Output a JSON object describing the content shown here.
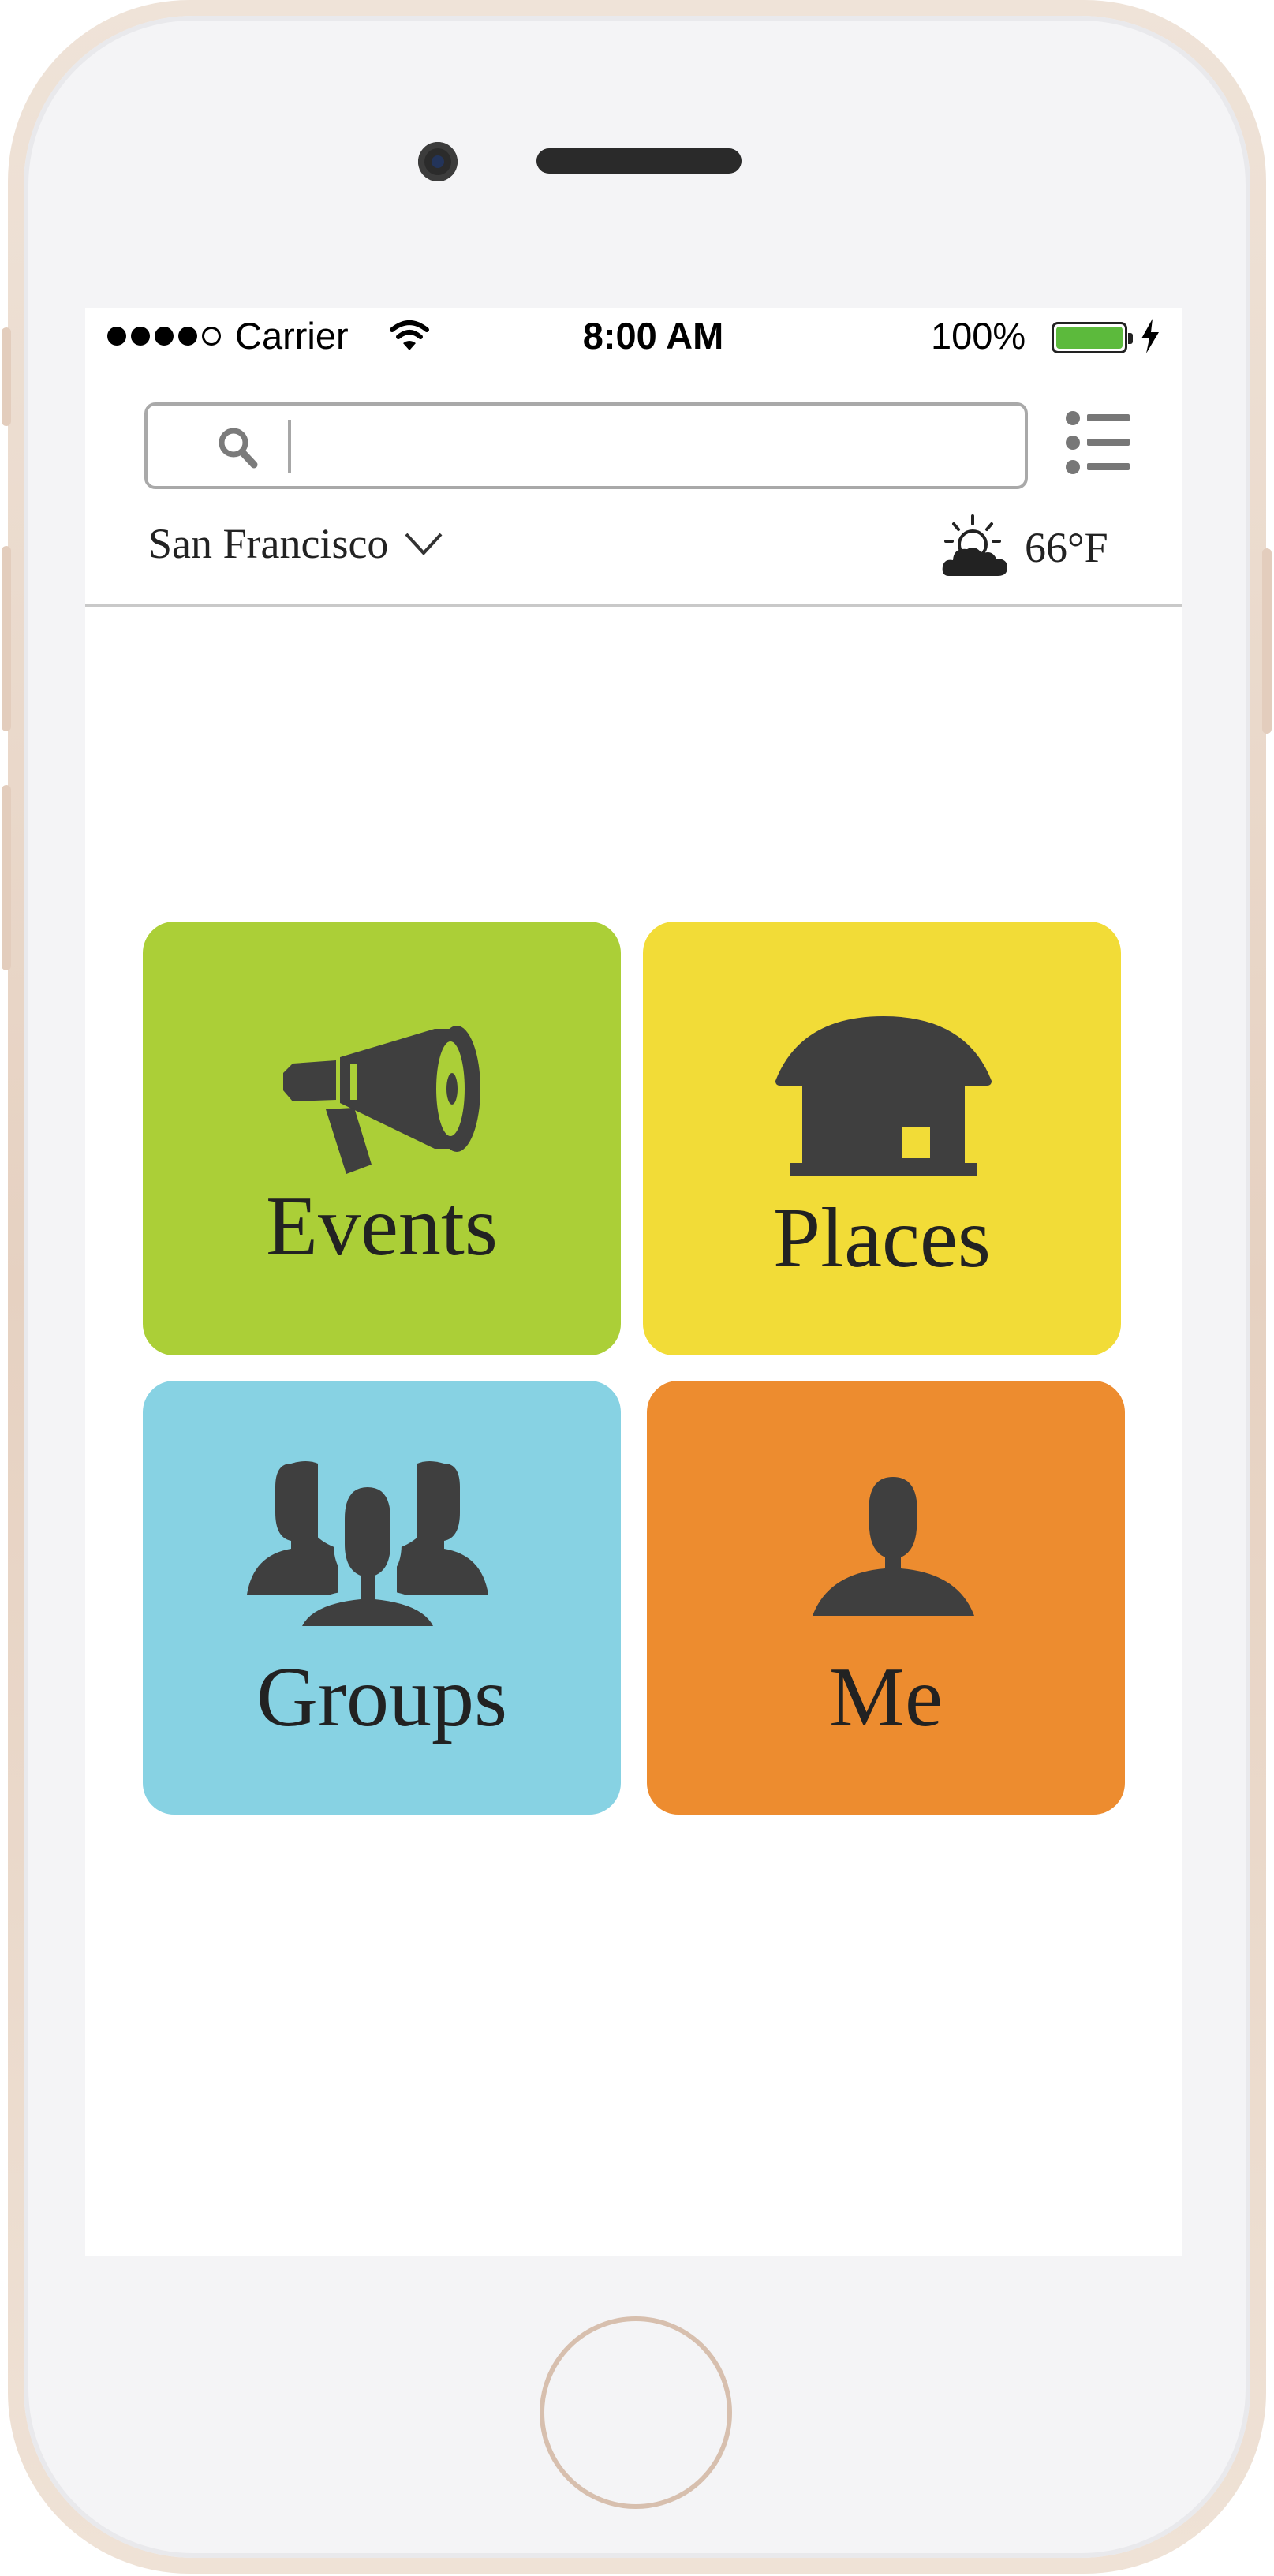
{
  "status_bar": {
    "carrier": "Carrier",
    "time": "8:00 AM",
    "battery": "100%",
    "battery_level": 1.0,
    "signal_bars_filled": 4,
    "signal_bars_total": 5
  },
  "search": {
    "value": "",
    "placeholder": ""
  },
  "location": {
    "city": "San Francisco"
  },
  "weather": {
    "temperature": "66°F",
    "icon": "partly-sunny-icon"
  },
  "tiles": [
    {
      "label": "Events",
      "icon": "megaphone-icon",
      "color": "#abcf37"
    },
    {
      "label": "Places",
      "icon": "building-icon",
      "color": "#f2dc37"
    },
    {
      "label": "Groups",
      "icon": "group-icon",
      "color": "#87d2e3"
    },
    {
      "label": "Me",
      "icon": "person-icon",
      "color": "#ed8c2f"
    }
  ]
}
